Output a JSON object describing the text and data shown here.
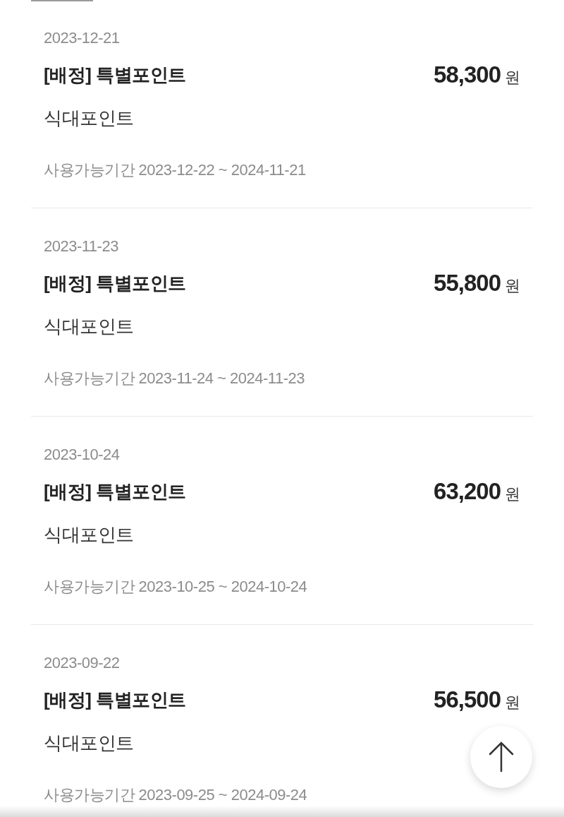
{
  "entries": [
    {
      "date": "2023-12-21",
      "title": "[배정] 특별포인트",
      "amount": "58,300",
      "currency": "원",
      "category": "식대포인트",
      "period": "사용가능기간 2023-12-22 ~ 2024-11-21"
    },
    {
      "date": "2023-11-23",
      "title": "[배정] 특별포인트",
      "amount": "55,800",
      "currency": "원",
      "category": "식대포인트",
      "period": "사용가능기간 2023-11-24 ~ 2024-11-23"
    },
    {
      "date": "2023-10-24",
      "title": "[배정] 특별포인트",
      "amount": "63,200",
      "currency": "원",
      "category": "식대포인트",
      "period": "사용가능기간 2023-10-25 ~ 2024-10-24"
    },
    {
      "date": "2023-09-22",
      "title": "[배정] 특별포인트",
      "amount": "56,500",
      "currency": "원",
      "category": "식대포인트",
      "period": "사용가능기간 2023-09-25 ~ 2024-09-24"
    }
  ]
}
